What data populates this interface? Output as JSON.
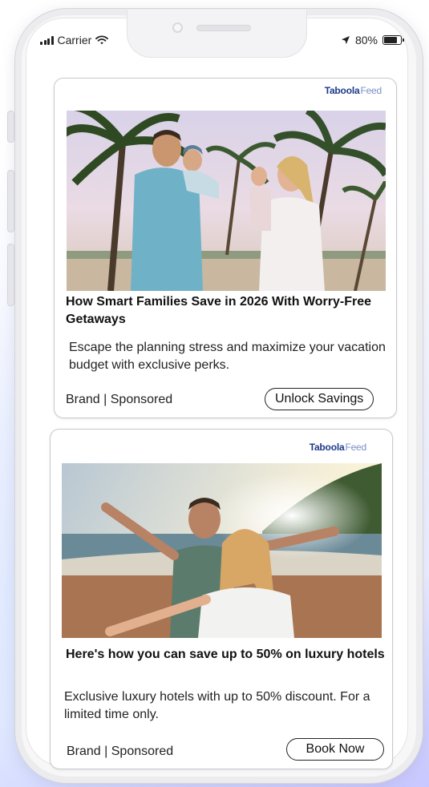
{
  "status_bar": {
    "carrier": "Carrier",
    "battery_percent": "80%",
    "battery_level": 0.8,
    "icons": [
      "signal-bars-icon",
      "wifi-icon",
      "location-arrow-icon",
      "battery-icon"
    ]
  },
  "cards": [
    {
      "brand": {
        "name": "Taboola",
        "suffix": "Feed"
      },
      "image_description": "family-on-tropical-beach-photo",
      "headline": "How Smart Families Save in 2026 With Worry-Free Getaways",
      "description": "Escape the planning stress and maximize your vacation budget with exclusive perks.",
      "sponsor_line": "Brand | Sponsored",
      "cta_label": "Unlock Savings"
    },
    {
      "brand": {
        "name": "Taboola",
        "suffix": "Feed"
      },
      "image_description": "couple-selfie-on-beach-photo",
      "headline": "Here's how you can save up to 50% on luxury hotels",
      "description": "Exclusive luxury hotels with up to 50% discount. For a limited time only.",
      "sponsor_line": "Brand | Sponsored",
      "cta_label": "Book Now"
    }
  ],
  "colors": {
    "brand_text": "#1d3a8a",
    "brand_feed": "#7a8fc6",
    "card_border": "#c9c9cf"
  }
}
